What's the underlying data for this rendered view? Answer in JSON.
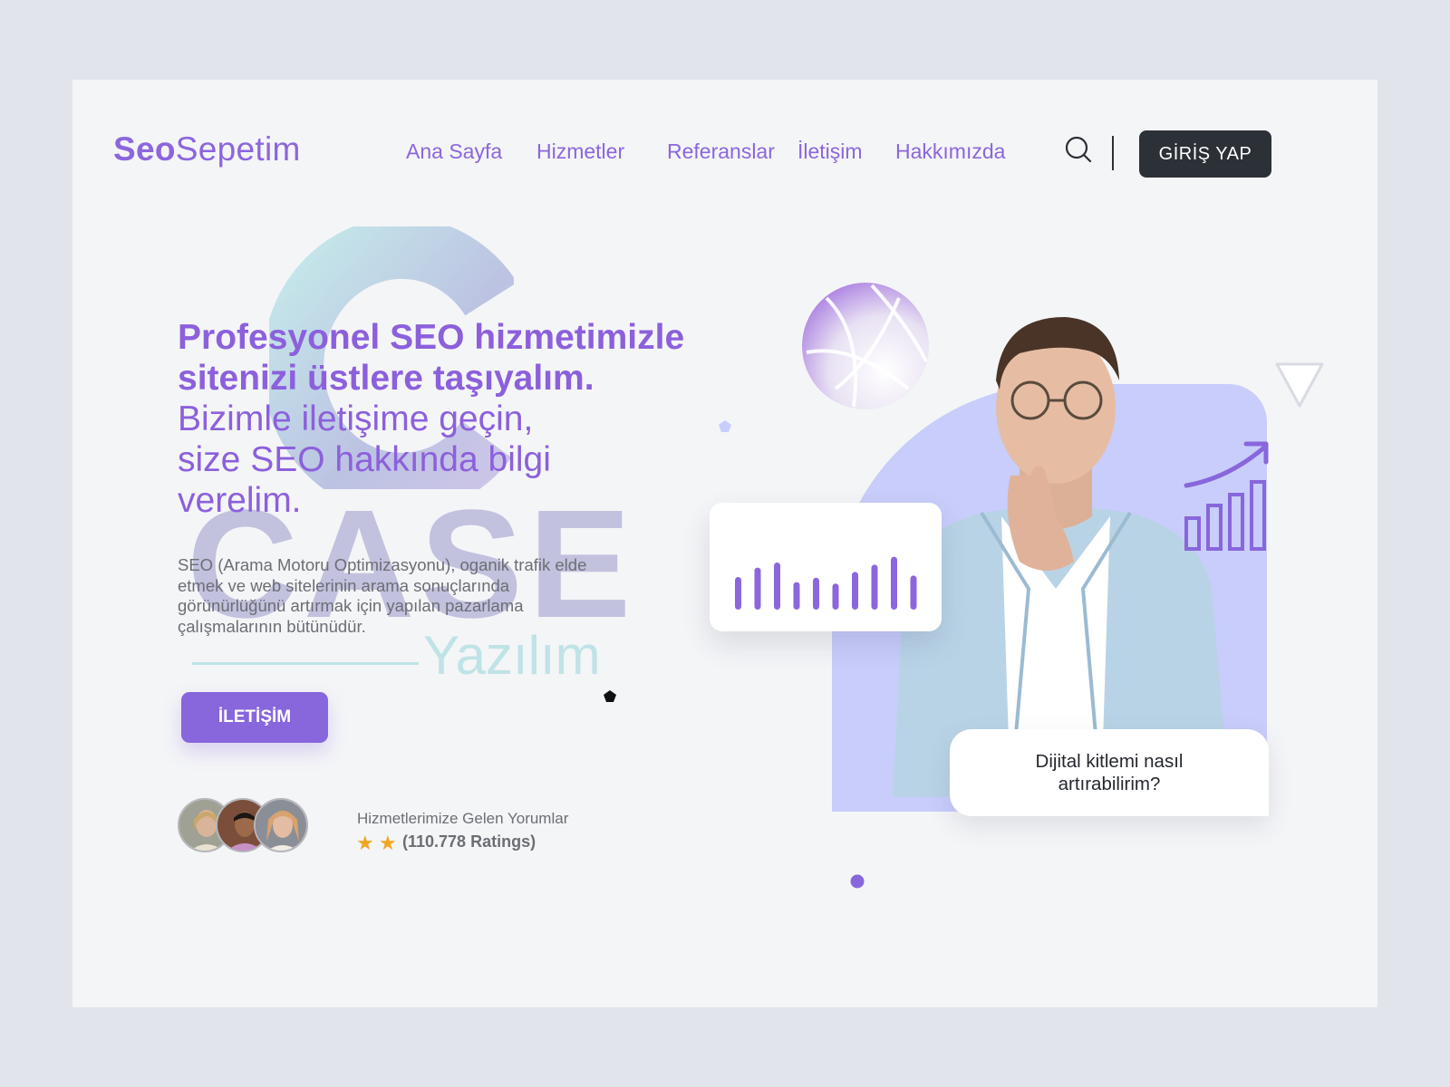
{
  "header": {
    "logo": {
      "bold": "Seo",
      "regular": "Sepetim"
    },
    "nav": [
      "Ana Sayfa",
      "Hizmetler",
      "Referanslar",
      "İletişim",
      "Hakkımızda"
    ],
    "login_label": "GİRİŞ YAP"
  },
  "watermark": {
    "case": "CASE",
    "yazilim": "Yazılım"
  },
  "hero": {
    "title": "Profesyonel SEO hizmetimizle sitenizi üstlere taşıyalım.",
    "subtitle_lines": [
      "Bizimle iletişime geçin,",
      "size SEO hakkında bilgi",
      "verelim."
    ],
    "description": "SEO (Arama Motoru Optimizasyonu), oganik trafik elde etmek ve web sitelerinin arama sonuçlarında görünürlüğünü artırmak için yapılan pazarlama çalışmalarının bütünüdür.",
    "contact_button": "İLETİŞİM"
  },
  "reviews": {
    "title": "Hizmetlerimize Gelen Yorumlar",
    "stars": 2,
    "ratings": "(110.778 Ratings)"
  },
  "chat": {
    "question": "Dijital kitlemi nasıl artırabilirim?"
  },
  "bars_card": {
    "values": [
      0.45,
      0.58,
      0.65,
      0.38,
      0.44,
      0.36,
      0.52,
      0.62,
      0.73,
      0.47
    ]
  },
  "icons": {
    "search": "search-icon",
    "ball": "volleyball-icon",
    "triangle": "triangle-icon",
    "growth": "growth-chart-icon"
  },
  "colors": {
    "accent": "#8c66dd",
    "dark_button": "#2c3138",
    "blob": "#c8cdfb",
    "star": "#f1a626",
    "background": "#f4f5f7"
  }
}
